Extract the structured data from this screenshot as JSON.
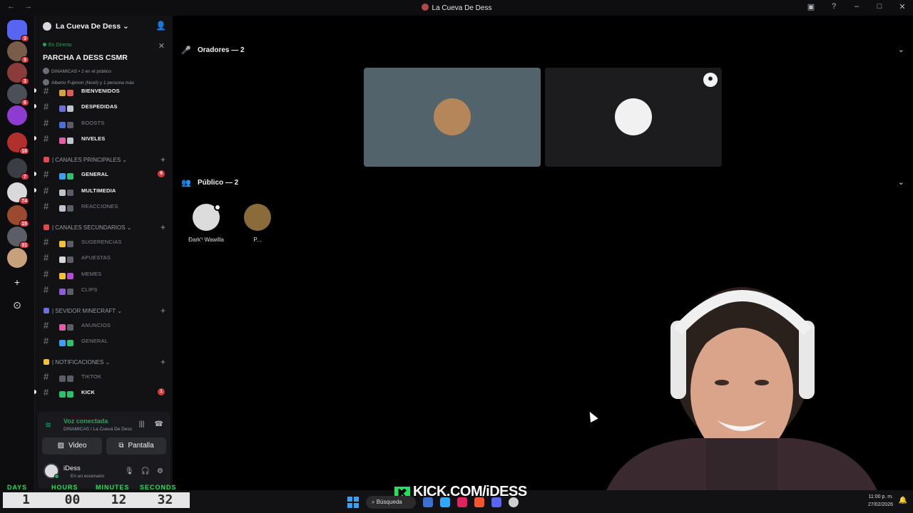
{
  "window": {
    "title": "La Cueva De Dess",
    "back_icon": "←",
    "forward_icon": "→",
    "controls": [
      "inbox-icon",
      "help-icon",
      "minimize-icon",
      "maximize-icon",
      "close-icon"
    ]
  },
  "rail": {
    "servers": [
      {
        "name": "discord-home",
        "color": "#5865f2",
        "badge": "3"
      },
      {
        "name": "server-1",
        "color": "#7a5c4a",
        "badge": "3"
      },
      {
        "name": "server-2",
        "color": "#8c3b3b",
        "badge": "3"
      },
      {
        "name": "server-3",
        "color": "#4b4f57",
        "badge": "6"
      },
      {
        "name": "server-4",
        "color": "#8e3bd1",
        "badge": ""
      },
      {
        "name": "server-5",
        "color": "#b1302e",
        "badge": "10"
      },
      {
        "name": "server-6",
        "color": "#3a3d44",
        "badge": "7"
      },
      {
        "name": "server-7",
        "color": "#d9d9d9",
        "badge": "74"
      },
      {
        "name": "server-8",
        "color": "#9c4a2f",
        "badge": "15"
      },
      {
        "name": "server-9",
        "color": "#5b5e66",
        "badge": "31"
      },
      {
        "name": "server-10",
        "color": "#c8a07a",
        "badge": ""
      }
    ],
    "add_icon": "+",
    "explore_icon": "⊙"
  },
  "server": {
    "name": "La Cueva De Dess",
    "chevron": "⌄"
  },
  "live_event": {
    "tag": "En Directo",
    "title": "PARCHA A DESS CSMR",
    "meta": "DINAMICAS • 2 en el público",
    "people": "Alberto Fujimori (Noxil) y 1 persona más",
    "close": "✕"
  },
  "channels": {
    "top": [
      {
        "label": "BIENVENIDOS",
        "state": "hot",
        "colors": [
          "#d8a23a",
          "#e05a5a"
        ]
      },
      {
        "label": "DESPEDIDAS",
        "state": "hot",
        "colors": [
          "#6b6fd6",
          "#c0c4cc"
        ]
      },
      {
        "label": "BOOSTS",
        "state": "mute",
        "colors": [
          "#4a6fd6",
          "#5a5d66"
        ]
      },
      {
        "label": "NIVELES",
        "state": "hot",
        "colors": [
          "#e25fa6",
          "#c0c4cc"
        ]
      }
    ],
    "categories": [
      {
        "label": "| CANALES PRINCIPALES",
        "pin_color": "#e2484e",
        "items": [
          {
            "label": "GENERAL",
            "state": "hot",
            "colors": [
              "#3aa0f3",
              "#2fbf71"
            ],
            "mention": "9"
          },
          {
            "label": "MULTIMEDIA",
            "state": "hot",
            "colors": [
              "#c0c4cc",
              "#5a5d66"
            ],
            "mention": ""
          },
          {
            "label": "REACCIONES",
            "state": "mute",
            "colors": [
              "#c0c4cc",
              "#5a5d66"
            ],
            "mention": ""
          }
        ]
      },
      {
        "label": "| CANALES SECUNDARIOS",
        "pin_color": "#e2484e",
        "items": [
          {
            "label": "SUGERENCIAS",
            "state": "mute",
            "colors": [
              "#f2c230",
              "#5a5d66"
            ],
            "mention": ""
          },
          {
            "label": "APUESTAS",
            "state": "mute",
            "colors": [
              "#d6d7da",
              "#5a5d66"
            ],
            "mention": ""
          },
          {
            "label": "MEMES",
            "state": "mute",
            "colors": [
              "#f2c230",
              "#b74ad6"
            ],
            "mention": ""
          },
          {
            "label": "CLIPS",
            "state": "mute",
            "colors": [
              "#8e5bd6",
              "#5a5d66"
            ],
            "mention": ""
          }
        ]
      },
      {
        "label": "| SEVIDOR MINECRAFT",
        "pin_color": "#6b6fd6",
        "items": [
          {
            "label": "ANUNCIOS",
            "state": "mute",
            "colors": [
              "#e25fa6",
              "#5a5d66"
            ],
            "mention": ""
          },
          {
            "label": "GENERAL",
            "state": "mute",
            "colors": [
              "#3aa0f3",
              "#2fbf71"
            ],
            "mention": ""
          }
        ]
      },
      {
        "label": "| NOTIFICACIONES",
        "pin_color": "#f2c230",
        "items": [
          {
            "label": "TIKTOK",
            "state": "mute",
            "colors": [
              "#5a5d66",
              "#5a5d66"
            ],
            "mention": ""
          },
          {
            "label": "KICK",
            "state": "hot",
            "colors": [
              "#2fbf71",
              "#2fbf71"
            ],
            "mention": "1"
          }
        ]
      }
    ]
  },
  "voice": {
    "status": "Voz conectada",
    "channel": "DINAMICAS / La Cueva De Dess",
    "video_label": "Video",
    "screen_label": "Pantalla",
    "user_name": "iDess",
    "user_status": "En un escenario"
  },
  "stage": {
    "speakers_title": "Oradores — 2",
    "audience_title": "Público — 2",
    "speakers": [
      {
        "name": "dog-avatar",
        "tile_color": "#52636b",
        "avatar_color": "#b5865a"
      },
      {
        "name": "girl-avatar",
        "tile_color": "#1c1c1f",
        "avatar_color": "#f1f1f1"
      }
    ],
    "audience": [
      {
        "name": "Ðark'ᵗ Wawilla",
        "avatar_color": "#dcdcdc"
      },
      {
        "name": "P...",
        "avatar_color": "#8c6b3a"
      }
    ]
  },
  "overlay": {
    "timer_labels": [
      "DAYS",
      "HOURS",
      "MINUTES",
      "SECONDS"
    ],
    "timer_values": [
      "1",
      "00",
      "12",
      "32"
    ],
    "kick_text": "KICK.COM/iDESS",
    "search_label": "Búsqueda",
    "clock_time": "11:00 p. m.",
    "clock_date": "27/02/2026"
  }
}
